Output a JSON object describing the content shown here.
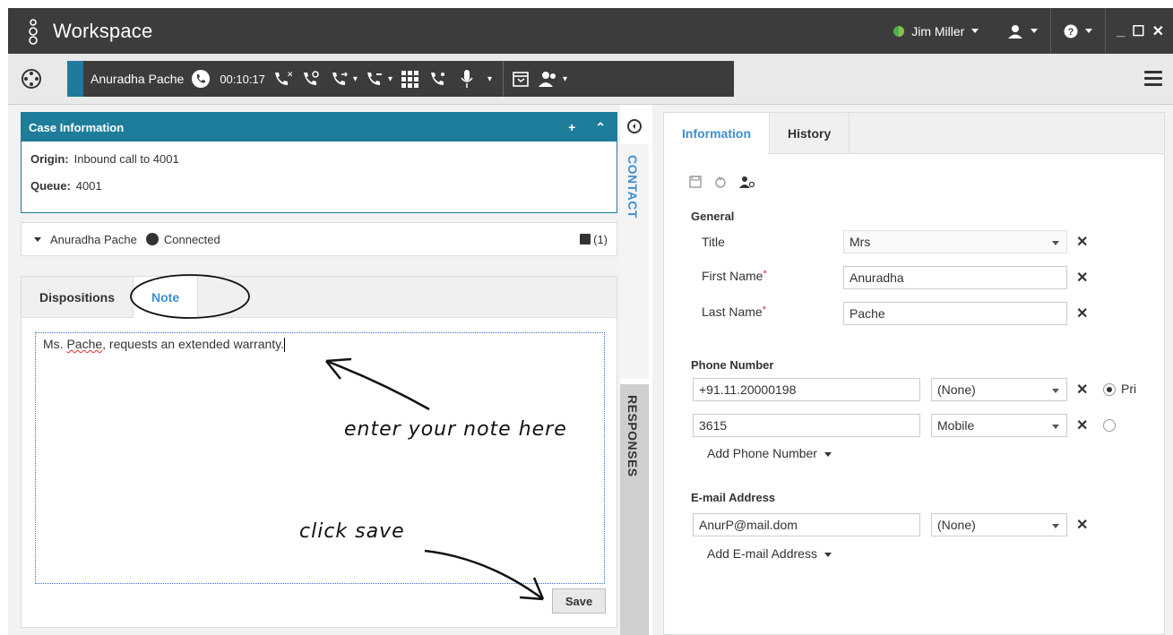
{
  "titlebar": {
    "app_title": "Workspace",
    "user_name": "Jim Miller"
  },
  "callbar": {
    "contact_name": "Anuradha Pache",
    "timer": "00:10:17"
  },
  "case": {
    "header": "Case Information",
    "origin_label": "Origin:",
    "origin_value": "Inbound call to 4001",
    "queue_label": "Queue:",
    "queue_value": "4001"
  },
  "party": {
    "name": "Anuradha Pache",
    "status": "Connected",
    "count": "(1)"
  },
  "note_panel": {
    "tabs": [
      "Dispositions",
      "Note"
    ],
    "active_tab": "Note",
    "note_text_part1": "Ms. ",
    "note_text_spell": "Pache",
    "note_text_part2": ", requests an extended warranty.",
    "save_label": "Save",
    "annotation_enter": "enter your note here",
    "annotation_save": "click save"
  },
  "side_tabs": {
    "contact": "CONTACT",
    "responses": "RESPONSES"
  },
  "contact": {
    "tabs": [
      "Information",
      "History"
    ],
    "general_title": "General",
    "title_label": "Title",
    "title_value": "Mrs",
    "first_name_label": "First Name",
    "first_name_value": "Anuradha",
    "last_name_label": "Last Name",
    "last_name_value": "Pache",
    "required_mark": "*",
    "phone_title": "Phone Number",
    "phones": [
      {
        "number": "+91.11.20000198",
        "type": "(None)",
        "primary_label": "Pri"
      },
      {
        "number": "3615",
        "type": "Mobile"
      }
    ],
    "add_phone": "Add Phone Number",
    "email_title": "E-mail Address",
    "email_value": "AnurP@mail.dom",
    "email_type": "(None)",
    "add_email": "Add E-mail Address"
  },
  "colors": {
    "titlebar_bg": "#3c3c3c",
    "case_header_bg": "#1e7d9b",
    "active_tab": "#3c8fd5"
  }
}
